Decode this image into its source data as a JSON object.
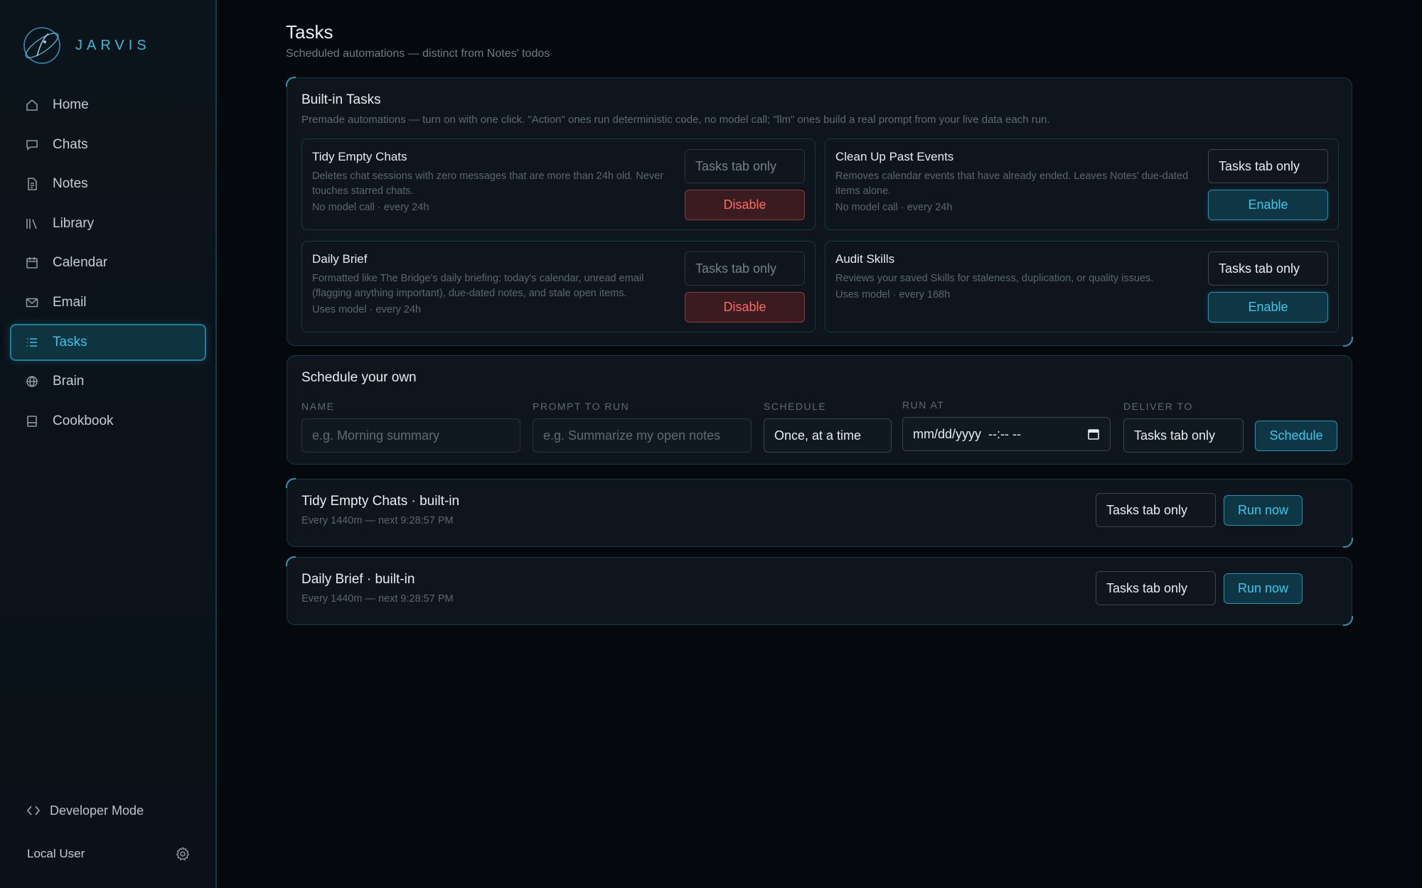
{
  "brand": {
    "name": "JARVIS",
    "logo_icon": "orbit-logo-icon"
  },
  "sidebar": {
    "items": [
      {
        "label": "Home",
        "icon": "home-icon"
      },
      {
        "label": "Chats",
        "icon": "chat-bubble-icon"
      },
      {
        "label": "Notes",
        "icon": "note-icon"
      },
      {
        "label": "Library",
        "icon": "library-icon"
      },
      {
        "label": "Calendar",
        "icon": "calendar-icon"
      },
      {
        "label": "Email",
        "icon": "envelope-icon"
      },
      {
        "label": "Tasks",
        "icon": "list-icon",
        "active": true
      },
      {
        "label": "Brain",
        "icon": "brain-icon"
      },
      {
        "label": "Cookbook",
        "icon": "cookbook-icon"
      }
    ],
    "developer_mode": "Developer Mode",
    "user": "Local User"
  },
  "page": {
    "title": "Tasks",
    "subtitle": "Scheduled automations — distinct from Notes' todos"
  },
  "builtin": {
    "title": "Built-in Tasks",
    "description": "Premade automations — turn on with one click. \"Action\" ones run deterministic code, no model call; \"llm\" ones build a real prompt from your live data each run.",
    "tasks": [
      {
        "name": "Tidy Empty Chats",
        "description": "Deletes chat sessions with zero messages that are more than 24h old. Never touches starred chats.",
        "meta": "No model call · every 24h",
        "deliver": "Tasks tab only",
        "button": "Disable",
        "enabled": true
      },
      {
        "name": "Clean Up Past Events",
        "description": "Removes calendar events that have already ended. Leaves Notes' due-dated items alone.",
        "meta": "No model call · every 24h",
        "deliver": "Tasks tab only",
        "button": "Enable",
        "enabled": false
      },
      {
        "name": "Daily Brief",
        "description": "Formatted like The Bridge's daily briefing: today's calendar, unread email (flagging anything important), due-dated notes, and stale open items.",
        "meta": "Uses model · every 24h",
        "deliver": "Tasks tab only",
        "button": "Disable",
        "enabled": true
      },
      {
        "name": "Audit Skills",
        "description": "Reviews your saved Skills for staleness, duplication, or quality issues.",
        "meta": "Uses model · every 168h",
        "deliver": "Tasks tab only",
        "button": "Enable",
        "enabled": false
      }
    ]
  },
  "schedule": {
    "title": "Schedule your own",
    "name_label": "NAME",
    "name_placeholder": "e.g. Morning summary",
    "prompt_label": "PROMPT TO RUN",
    "prompt_placeholder": "e.g. Summarize my open notes",
    "schedule_label": "SCHEDULE",
    "schedule_value": "Once, at a time",
    "run_at_label": "RUN AT",
    "run_at_value": "mm/dd/yyyy  --:-- --",
    "deliver_label": "DELIVER TO",
    "deliver_value": "Tasks tab only",
    "button": "Schedule"
  },
  "scheduled": [
    {
      "name": "Tidy Empty Chats · built-in",
      "meta": "Every 1440m — next 9:28:57 PM",
      "deliver": "Tasks tab only",
      "button": "Run now"
    },
    {
      "name": "Daily Brief · built-in",
      "meta": "Every 1440m — next 9:28:57 PM",
      "deliver": "Tasks tab only",
      "button": "Run now"
    }
  ],
  "colors": {
    "accent": "#39c4e5",
    "danger": "#ff6a66",
    "background": "#05080c"
  }
}
